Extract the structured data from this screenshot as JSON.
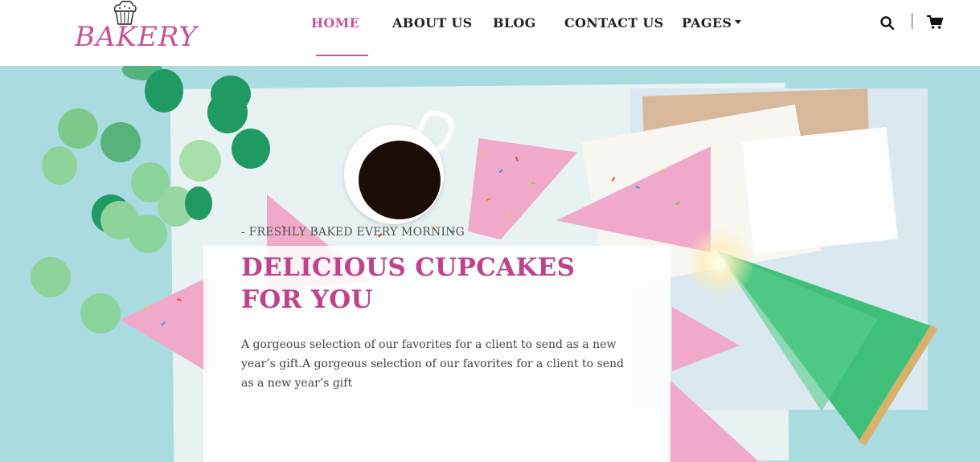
{
  "brand": {
    "name": "BAKERY",
    "logo_icon": "cupcake-icon",
    "color": "#c8529a"
  },
  "nav": {
    "items": [
      {
        "label": "HOME",
        "active": true
      },
      {
        "label": "ABOUT US",
        "active": false
      },
      {
        "label": "BLOG",
        "active": false
      },
      {
        "label": "CONTACT US",
        "active": false
      },
      {
        "label": "PAGES",
        "active": false,
        "has_dropdown": true
      }
    ]
  },
  "header_icons": {
    "search": "search-icon",
    "cart": "cart-icon"
  },
  "hero": {
    "eyebrow": "- FRESHLY BAKED EVERY MORNING",
    "title": "DELICIOUS CUPCAKES FOR YOU",
    "description": "A gorgeous selection of our favorites for a client to send as a new year’s gift.A gorgeous selection of our favorites for a client to send as a new year’s gift"
  },
  "colors": {
    "accent": "#c0428a",
    "hero_bg": "#a9dbe1"
  }
}
